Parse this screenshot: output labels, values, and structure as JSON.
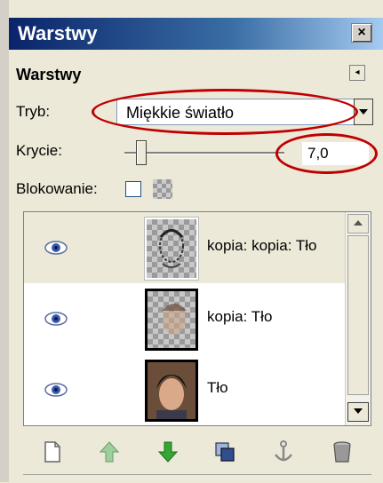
{
  "window": {
    "title": "Warstwy",
    "close_label": "×"
  },
  "panel": {
    "section_title": "Warstwy",
    "menu_arrow": "◂",
    "mode_label": "Tryb:",
    "mode_value": "Miękkie światło",
    "opacity_label": "Krycie:",
    "opacity_value": "7,0",
    "opacity_level": 0.07,
    "lock_label": "Blokowanie:"
  },
  "layers": [
    {
      "name": "kopia: kopia: Tło",
      "visible": true,
      "selected": true
    },
    {
      "name": "kopia: Tło",
      "visible": true,
      "selected": false
    },
    {
      "name": "Tło",
      "visible": true,
      "selected": false
    }
  ],
  "icons": {
    "new": "new-layer-icon",
    "raise": "raise-layer-icon",
    "lower": "lower-layer-icon",
    "duplicate": "duplicate-layer-icon",
    "anchor": "anchor-layer-icon",
    "delete": "delete-layer-icon"
  },
  "colors": {
    "highlight_ellipse": "#c00000",
    "title_gradient_start": "#0a246a",
    "raise_arrow": "#9ccf9c",
    "lower_arrow": "#33a633"
  }
}
